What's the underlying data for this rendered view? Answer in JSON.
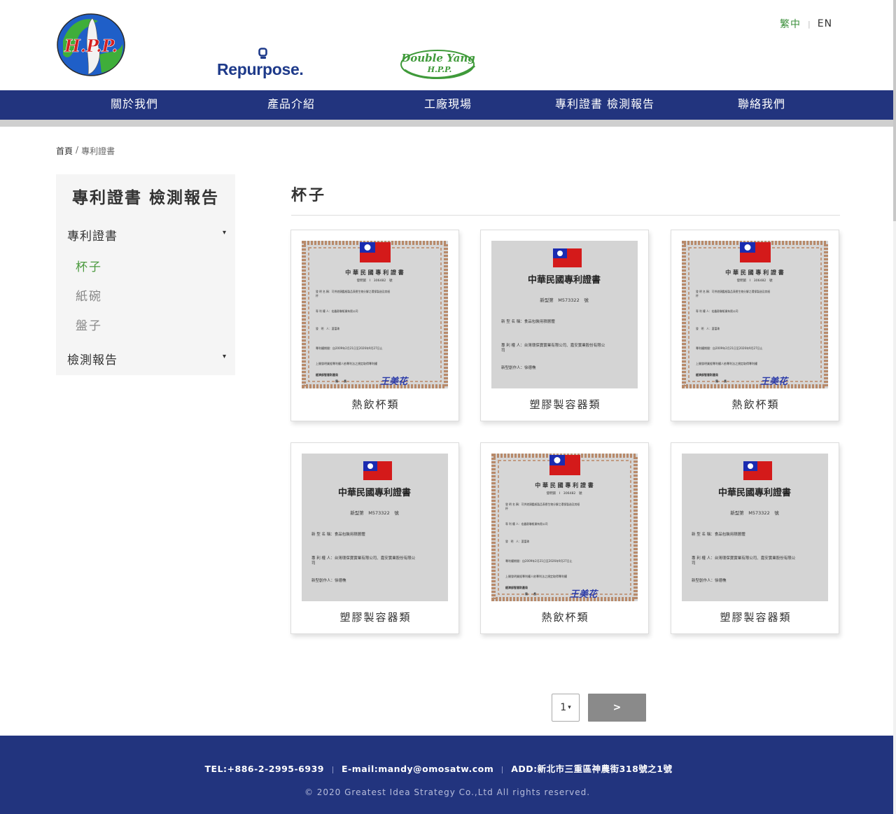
{
  "header": {
    "logo_hpp": "H.P.P.",
    "logo_repurpose": "Repurpose.",
    "logo_doubleyang_top": "Double Yang",
    "logo_doubleyang_bottom": "H.P.P.",
    "lang_zh": "繁中",
    "lang_sep": "|",
    "lang_en": "EN"
  },
  "nav": {
    "items": [
      {
        "label": "關於我們"
      },
      {
        "label": "產品介紹"
      },
      {
        "label": "工廠現場"
      },
      {
        "label": "專利證書 檢測報告"
      },
      {
        "label": "聯絡我們"
      }
    ]
  },
  "breadcrumb": {
    "home": "首頁",
    "sep": "/",
    "current": "專利證書"
  },
  "sidebar": {
    "title": "專利證書 檢測報告",
    "cat1": "專利證書",
    "cat1_arrow": "▾",
    "subs": [
      "杯子",
      "紙碗",
      "盤子"
    ],
    "cat2": "檢測報告",
    "cat2_arrow": "▾"
  },
  "main": {
    "title": "杯子",
    "cards": [
      {
        "caption": "熱飲杯類",
        "type": "ornate"
      },
      {
        "caption": "塑膠製容器類",
        "type": "plain"
      },
      {
        "caption": "熱飲杯類",
        "type": "ornate"
      },
      {
        "caption": "塑膠製容器類",
        "type": "plain"
      },
      {
        "caption": "熱飲杯類",
        "type": "ornate"
      },
      {
        "caption": "塑膠製容器類",
        "type": "plain"
      }
    ],
    "cert_ornate": {
      "heading": "中 華 民 國 專 利 證 書",
      "number": "發明第　I　306482　號",
      "row1": "發 明 名 稱：可供遊頭鑑紙製品表層生物分解之環保製造及其紙",
      "row1b": "杯",
      "row2": "專 利 權 人：宏鑫歐聯紙業有限公司",
      "row3": "發　明　人：蕭富珠",
      "row4": "專利權期間：自2009年2月21日至2026年9月27日止",
      "row5": "上開發明業經專利權人依專利法之規定取得專利權",
      "row6": "經濟部智慧財產局",
      "row7": "局　　長",
      "sign": "王美花"
    },
    "cert_plain": {
      "heading": "中華民國專利證書",
      "number": "新型第　M573322　號",
      "row1": "新 型 名 稱：食品包裝用積層體",
      "row2": "專 利 權 人：台灣環保寶實業有限公司、嘉安實業股份有限公",
      "row2b": "司",
      "row3": "新型創作人：徐德樵"
    }
  },
  "pager": {
    "current": "1",
    "caret": "▾",
    "next": ">"
  },
  "footer": {
    "tel": "TEL:+886-2-2995-6939",
    "email": "E-mail:mandy@omosatw.com",
    "addr": "ADD:新北市三重區神農街318號之1號",
    "copyright": "© 2020 Greatest Idea Strategy Co.,Ltd All rights reserved."
  },
  "colors": {
    "nav_bg": "#22347e",
    "footer_bg": "#22347e",
    "active_green": "#4c9a3f",
    "pager_next_bg": "#8a8a8a"
  }
}
